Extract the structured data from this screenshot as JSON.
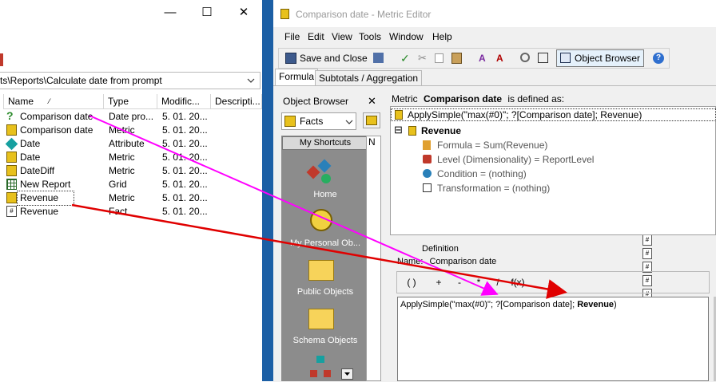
{
  "left_window": {
    "controls": {
      "minimize": "—",
      "maximize": "☐",
      "close": "✕"
    },
    "address": "ts\\Reports\\Calculate date from prompt",
    "columns": [
      "Name",
      "Type",
      "Modific...",
      "Descripti..."
    ],
    "sort_indicator": "⁄",
    "rows": [
      {
        "name": "Comparison date",
        "type": "Date pro...",
        "modified": "5. 01. 20...",
        "icon": "prompt-icon"
      },
      {
        "name": "Comparison date",
        "type": "Metric",
        "modified": "5. 01. 20...",
        "icon": "metric-icon"
      },
      {
        "name": "Date",
        "type": "Attribute",
        "modified": "5. 01. 20...",
        "icon": "attribute-icon"
      },
      {
        "name": "Date",
        "type": "Metric",
        "modified": "5. 01. 20...",
        "icon": "metric-icon"
      },
      {
        "name": "DateDiff",
        "type": "Metric",
        "modified": "5. 01. 20...",
        "icon": "metric-icon"
      },
      {
        "name": "New Report",
        "type": "Grid",
        "modified": "5. 01. 20...",
        "icon": "grid-report-icon"
      },
      {
        "name": "Revenue",
        "type": "Metric",
        "modified": "5. 01. 20...",
        "icon": "metric-icon"
      },
      {
        "name": "Revenue",
        "type": "Fact",
        "modified": "5. 01. 20...",
        "icon": "fact-icon"
      }
    ]
  },
  "metric_editor": {
    "title": "Comparison date - Metric Editor",
    "menu": [
      "File",
      "Edit",
      "View",
      "Tools",
      "Window",
      "Help"
    ],
    "toolbar": {
      "save_close": "Save and Close",
      "object_browser": "Object Browser"
    },
    "tabs": [
      "Formula",
      "Subtotals / Aggregation"
    ],
    "object_browser": {
      "title": "Object Browser",
      "close": "✕",
      "folder": "Facts",
      "shortcuts_header": "My Shortcuts",
      "shortcuts": [
        "Home",
        "My Personal Ob...",
        "Public Objects",
        "Schema Objects"
      ],
      "list_header": "N"
    },
    "metric_def": {
      "prefix": "Metric",
      "metric_name": "Comparison date",
      "suffix": "is defined as:",
      "expression": "ApplySimple(\"max(#0)\"; ?[Comparison date]; Revenue)",
      "node": "Revenue",
      "expand": "⊟",
      "properties": [
        "Formula = Sum(Revenue)",
        "Level (Dimensionality) = ReportLevel",
        "Condition = (nothing)",
        "Transformation = (nothing)"
      ]
    },
    "definition": {
      "title": "Definition",
      "name_label": "Name:",
      "name_value": "Comparison date",
      "buttons": [
        "( )",
        "+",
        "-",
        "*",
        "/",
        "f(x)"
      ],
      "formula_prefix": "ApplySimple(\"max(#0)\"; ?[Comparison date]; ",
      "formula_bold": "Revenue",
      "formula_suffix": ")"
    }
  },
  "annotations": {
    "magenta_arrow_color": "#ff00ff",
    "red_arrow_color": "#e00000"
  }
}
